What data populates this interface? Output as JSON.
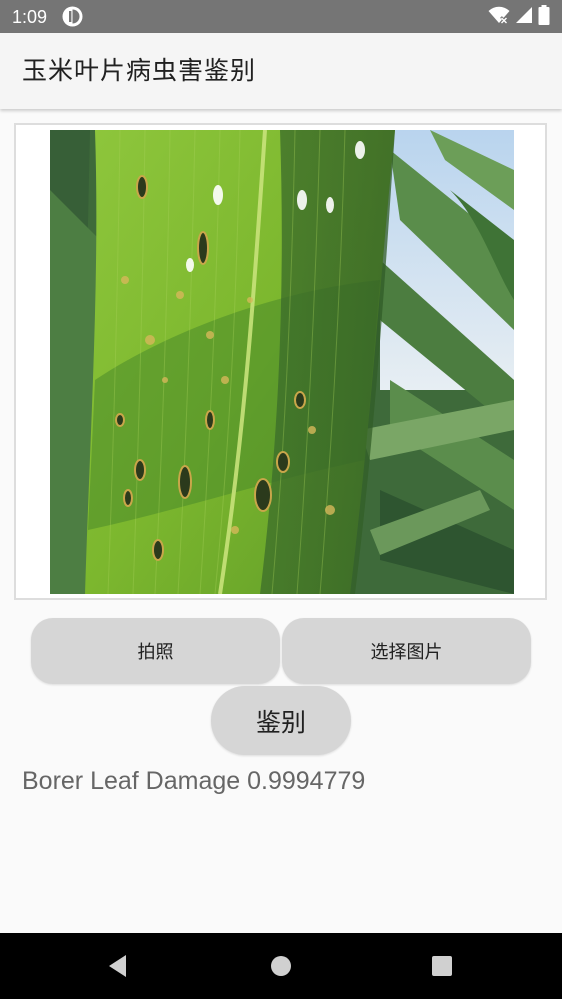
{
  "status_bar": {
    "time": "1:09",
    "icons": [
      "app-notification-icon",
      "wifi-icon",
      "signal-icon",
      "battery-icon"
    ]
  },
  "app_bar": {
    "title": "玉米叶片病虫害鉴别"
  },
  "image_card": {
    "image": "corn-leaf-photo"
  },
  "buttons": {
    "take_photo": "拍照",
    "choose_image": "选择图片",
    "identify": "鉴别"
  },
  "result": {
    "text": "Borer Leaf Damage 0.9994779"
  },
  "nav_bar": {
    "icons": [
      "back-icon",
      "home-icon",
      "recents-icon"
    ]
  },
  "colors": {
    "status_bar": "#757575",
    "app_bar": "#f5f5f5",
    "background": "#fafafa",
    "button": "#d6d6d6",
    "result_text": "#666666",
    "nav_bar": "#000000"
  }
}
